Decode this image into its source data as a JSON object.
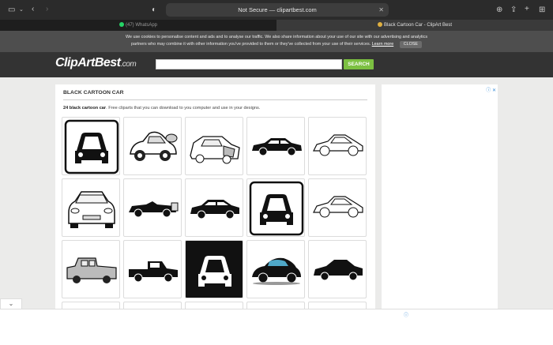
{
  "browser": {
    "url": "Not Secure — clipartbest.com",
    "tabs": [
      {
        "label": "(47) WhatsApp"
      },
      {
        "label": "Black Cartoon Car - ClipArt Best"
      }
    ]
  },
  "cookie": {
    "line1": "We use cookies to personalise content and ads and to analyse our traffic. We also share information about your use of our site with our advertising and analytics",
    "line2": "partners who may combine it with other information you've provided to them or they've collected from your use of their services.",
    "learn_more": "Learn more",
    "close": "CLOSE"
  },
  "header": {
    "logo": "ClipArtBest",
    "logo_suffix": ".com",
    "search_value": "",
    "search_button": "SEARCH"
  },
  "content": {
    "title": "BLACK CARTOON CAR",
    "desc_bold": "24 black cartoon car",
    "desc_rest": ". Free cliparts that you can download to you computer and use in your designs."
  },
  "colors": {
    "accent_green": "#7cc041",
    "header_bg": "#333333"
  }
}
